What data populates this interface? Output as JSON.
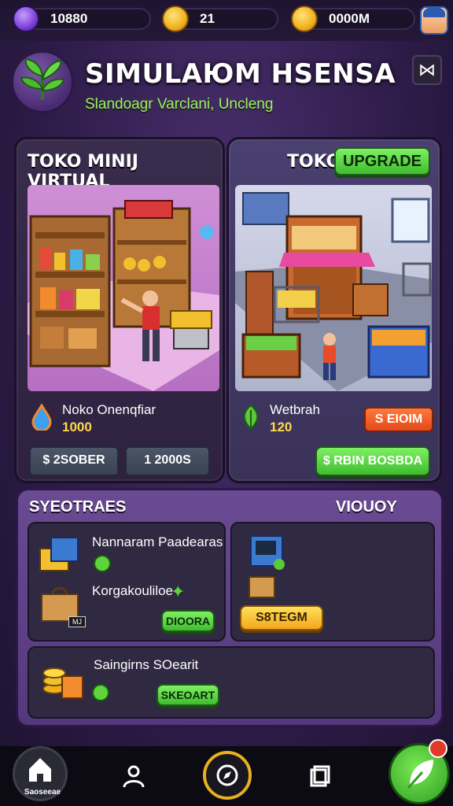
{
  "topbar": {
    "stat1": "10880",
    "stat2": "21",
    "stat3": "0000M"
  },
  "header": {
    "title": "SIMULAЮM HSENSA",
    "subtitle": "Slandoagr Varclani, Uncleng"
  },
  "left_card": {
    "title": "TOKO MINIJ VIRTUAL",
    "stat_label": "Noko Onenqfiar",
    "stat_value": "1000",
    "button1": "$ 2SOBER",
    "button2": "1 2000S"
  },
  "right_card": {
    "title": "TOKO",
    "upgrade_label": "UPGRADE",
    "stat_label": "Wetbrah",
    "stat_value": "120",
    "orange_button": "S EIOIM",
    "green_button": "$ RBIN BOSBDA"
  },
  "panel": {
    "title_left": "SYEOTRAES",
    "title_right": "VIOUOY",
    "item1_name": "Nannaram Paadearas",
    "item2_name": "Korgakouliloe",
    "item2_badge": "MJ",
    "button_item": "DIOORA",
    "right_button": "S8TEGM",
    "item3_name": "Saingirns SOearit",
    "button_item3": "SKEOART"
  },
  "navbar": {
    "home_label": "Saoseeae"
  },
  "colors": {
    "accent_green": "#5fd43a",
    "accent_orange": "#e2491a",
    "accent_yellow": "#f2b01e",
    "background": "#2c1b47"
  }
}
